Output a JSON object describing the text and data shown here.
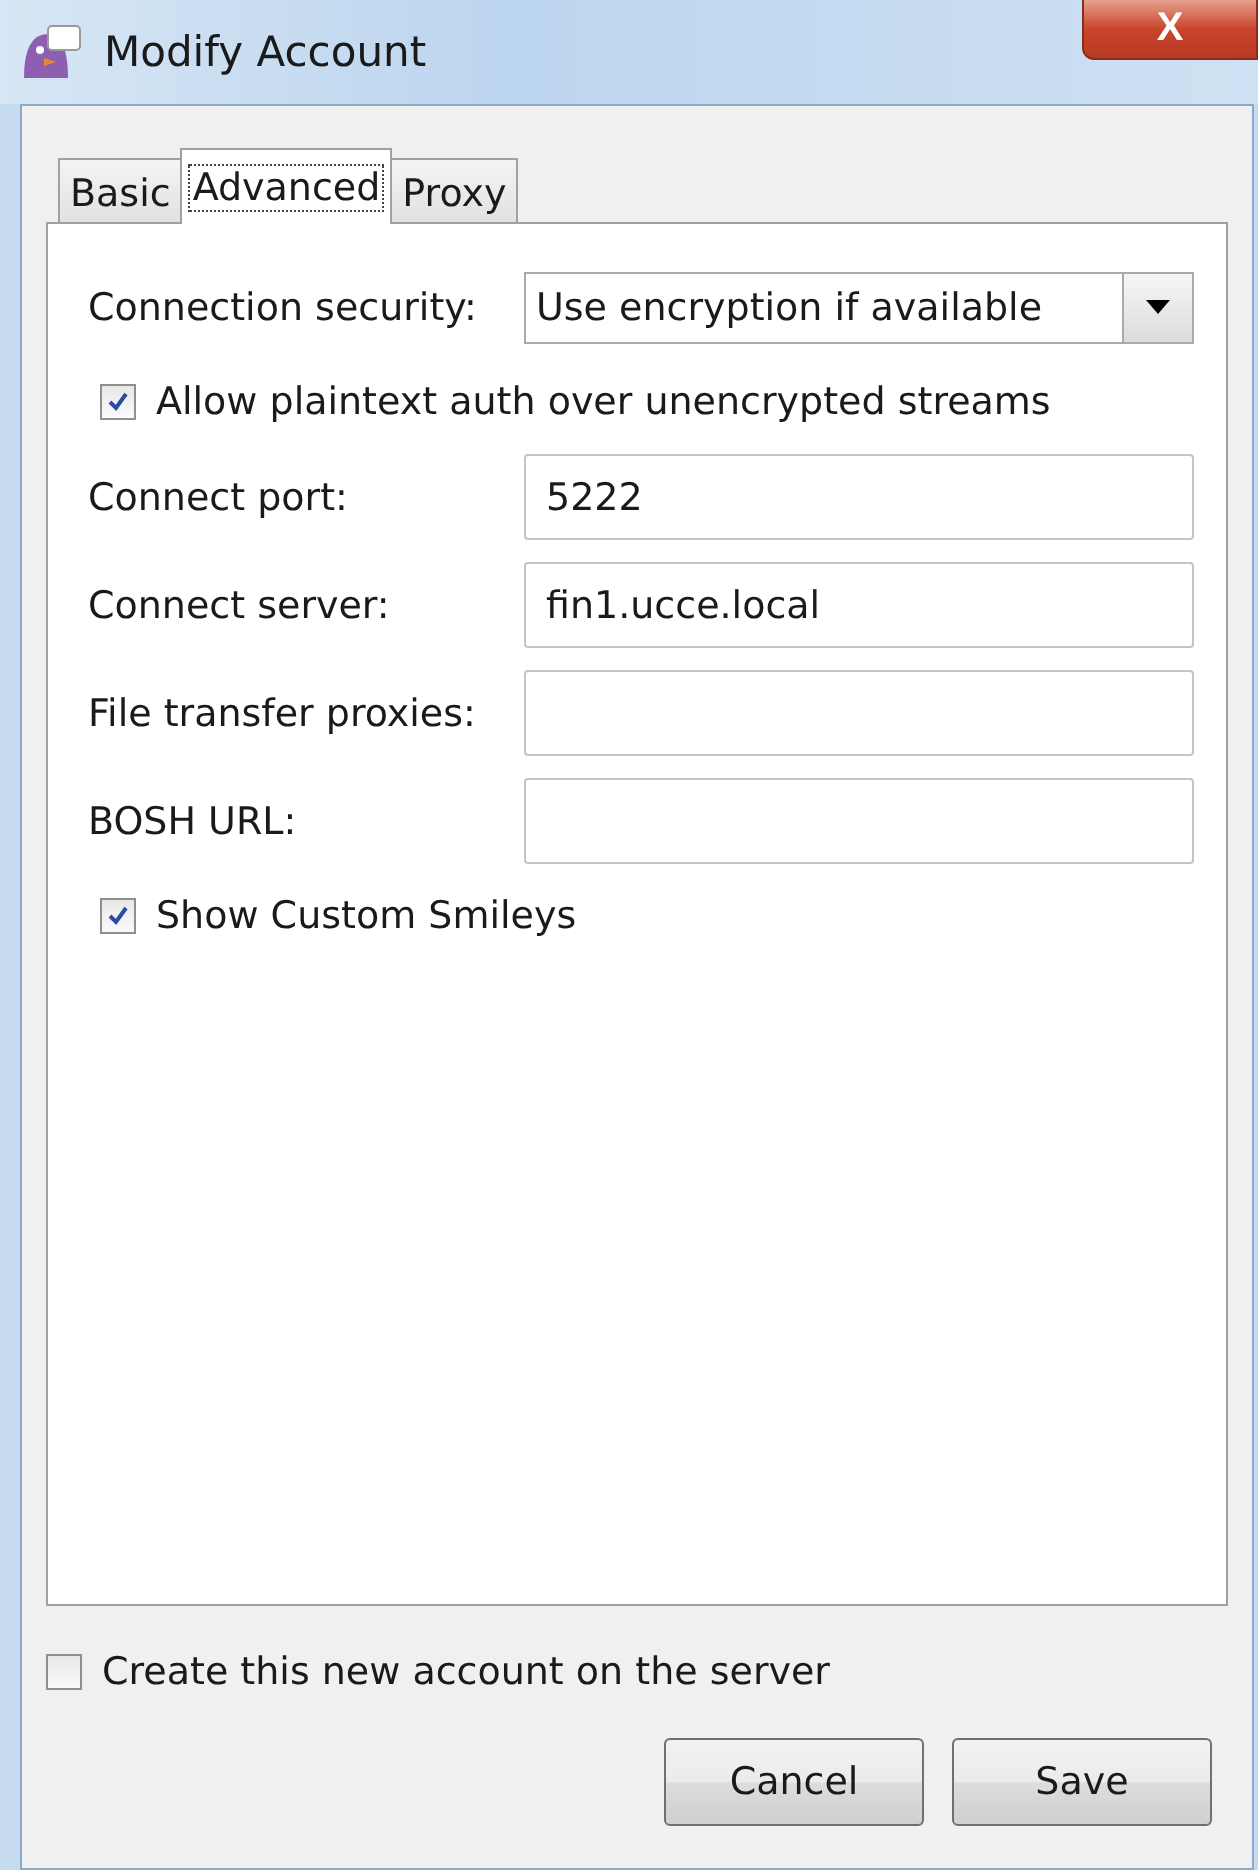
{
  "window": {
    "title": "Modify Account",
    "close": "X"
  },
  "tabs": [
    {
      "label": "Basic",
      "selected": false
    },
    {
      "label": "Advanced",
      "selected": true
    },
    {
      "label": "Proxy",
      "selected": false
    }
  ],
  "fields": [
    {
      "kind": "select",
      "label": "Connection security:",
      "value": "Use encryption if available"
    },
    {
      "kind": "checkbox",
      "label": "Allow plaintext auth over unencrypted streams",
      "checked": true
    },
    {
      "kind": "text",
      "label": "Connect port:",
      "value": "5222"
    },
    {
      "kind": "text",
      "label": "Connect server:",
      "value": "fin1.ucce.local"
    },
    {
      "kind": "text",
      "label": "File transfer proxies:"
    },
    {
      "kind": "text",
      "label": "BOSH URL:"
    },
    {
      "kind": "checkbox",
      "label": "Show Custom Smileys",
      "checked": true
    }
  ],
  "create_account": {
    "label": "Create this new account on the server",
    "checked": false
  },
  "buttons": [
    "Cancel",
    "Save"
  ]
}
